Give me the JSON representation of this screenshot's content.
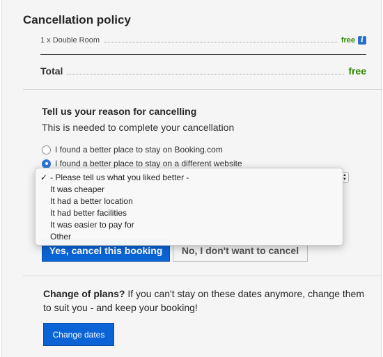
{
  "cancellation": {
    "title": "Cancellation policy",
    "room_label": "1 x Double Room",
    "room_price": "free",
    "total_label": "Total",
    "total_price": "free"
  },
  "reason": {
    "heading": "Tell us your reason for cancelling",
    "subheading": "This is needed to complete your cancellation",
    "options": [
      {
        "label": "I found a better place to stay on Booking.com",
        "selected": false
      },
      {
        "label": "I found a better place to stay on a different website",
        "selected": true
      }
    ],
    "dropdown": {
      "items": [
        "- Please tell us what you liked better -",
        "It was cheaper",
        "It had a better location",
        "It had better facilities",
        "It was easier to pay for",
        "Other"
      ],
      "selected_index": 0
    }
  },
  "actions": {
    "confirm_label": "Yes, cancel this booking",
    "decline_label": "No, I don't want to cancel"
  },
  "plans": {
    "bold": "Change of plans?",
    "text": " If you can't stay on these dates anymore, change them to suit you - and keep your booking!",
    "button_label": "Change dates"
  },
  "colors": {
    "accent": "#0a64d6",
    "free": "#2d8a00",
    "panel": "#f5f5f5"
  }
}
